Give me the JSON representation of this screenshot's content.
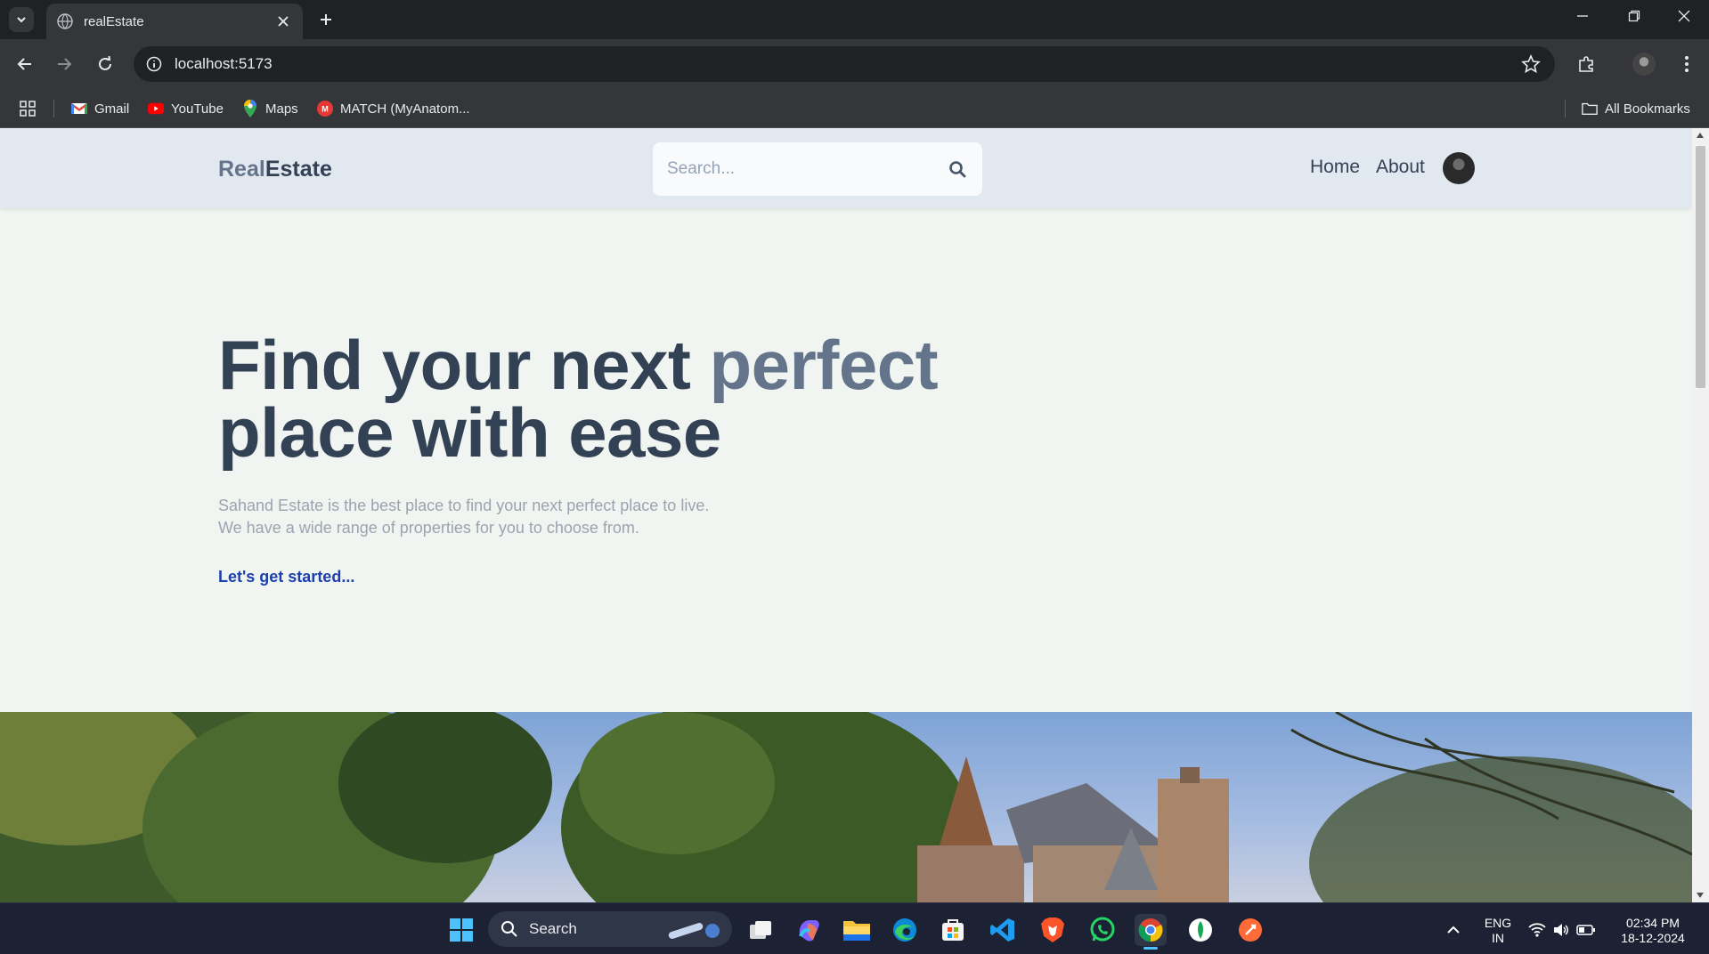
{
  "browser": {
    "tab_title": "realEstate",
    "url": "localhost:5173",
    "bookmarks": [
      {
        "label": "Gmail",
        "icon": "gmail-icon"
      },
      {
        "label": "YouTube",
        "icon": "youtube-icon"
      },
      {
        "label": "Maps",
        "icon": "maps-icon"
      },
      {
        "label": "MATCH (MyAnatom...",
        "icon": "match-icon"
      }
    ],
    "all_bookmarks": "All Bookmarks"
  },
  "site": {
    "logo_part1": "Real",
    "logo_part2": "Estate",
    "search_placeholder": "Search...",
    "nav": {
      "home": "Home",
      "about": "About"
    }
  },
  "hero": {
    "title_line1_a": "Find your next ",
    "title_line1_b": "perfect",
    "title_line2": "place with ease",
    "subtitle_line1": "Sahand Estate is the best place to find your next perfect place to live.",
    "subtitle_line2": "We have a wide range of properties for you to choose from.",
    "cta": "Let's get started..."
  },
  "taskbar": {
    "search_label": "Search",
    "language_line1": "ENG",
    "language_line2": "IN",
    "time": "02:34 PM",
    "date": "18-12-2024"
  },
  "colors": {
    "header_bg": "#e2e8f0",
    "page_bg": "#f1f5f1",
    "title_dark": "#334155",
    "title_accent": "#64748b",
    "cta": "#1e40af"
  }
}
